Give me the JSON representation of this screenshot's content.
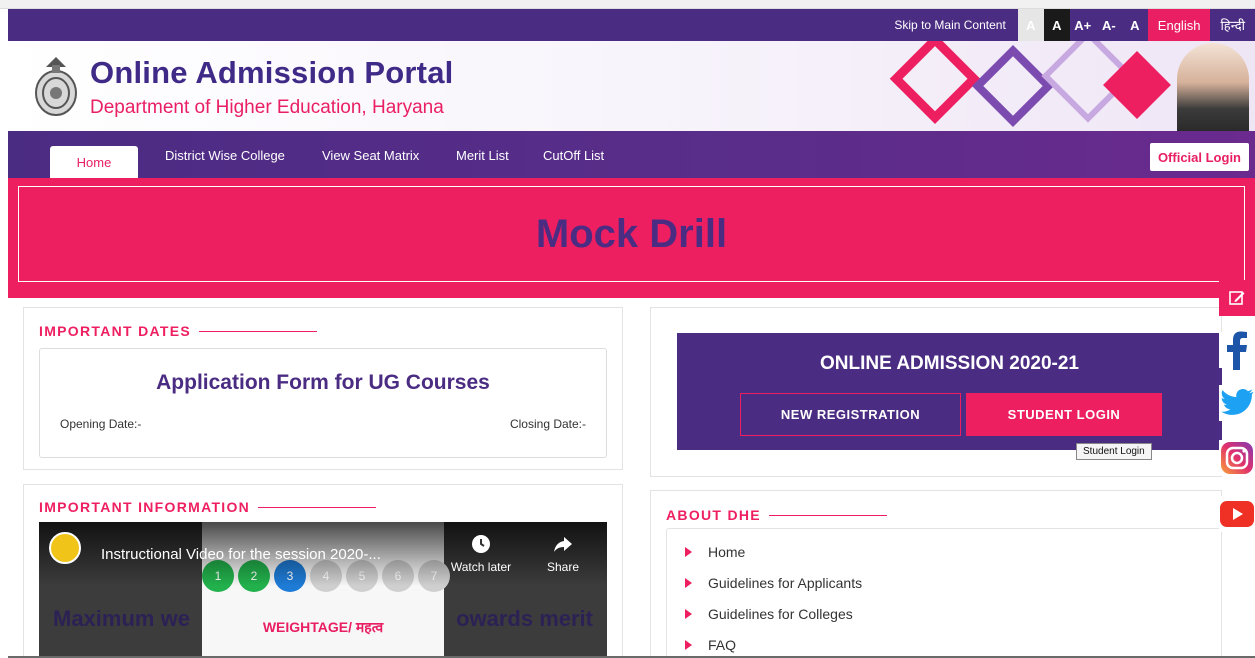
{
  "topbar": {
    "skip": "Skip to Main Content",
    "font_sizes": [
      "A",
      "A",
      "A+",
      "A-",
      "A"
    ],
    "lang_english": "English",
    "lang_hindi": "हिन्दी"
  },
  "header": {
    "title": "Online Admission Portal",
    "subtitle": "Department of Higher Education, Haryana"
  },
  "nav": {
    "home": "Home",
    "items": [
      "District Wise College",
      "View Seat Matrix",
      "Merit List",
      "CutOff List"
    ],
    "official_login": "Official Login"
  },
  "banner": {
    "text": "Mock Drill"
  },
  "important_dates": {
    "heading": "IMPORTANT DATES",
    "title": "Application Form for UG Courses",
    "opening": "Opening Date:-",
    "closing": "Closing Date:-"
  },
  "important_info": {
    "heading": "IMPORTANT INFORMATION",
    "video_title": "Instructional Video for the session 2020-...",
    "watch_later": "Watch later",
    "share": "Share",
    "bg_left": "Maximum we",
    "bg_right": "owards merit",
    "steps": [
      "1",
      "2",
      "3",
      "4",
      "5",
      "6",
      "7"
    ],
    "weightage": "WEIGHTAGE/ महत्व"
  },
  "admission": {
    "title": "ONLINE ADMISSION 2020-21",
    "new_registration": "NEW REGISTRATION",
    "student_login": "STUDENT LOGIN",
    "tooltip": "Student Login"
  },
  "about": {
    "heading": "ABOUT DHE",
    "items": [
      "Home",
      "Guidelines for Applicants",
      "Guidelines for Colleges",
      "FAQ"
    ]
  },
  "colors": {
    "purple": "#4b2c83",
    "pink": "#ee1f60"
  }
}
